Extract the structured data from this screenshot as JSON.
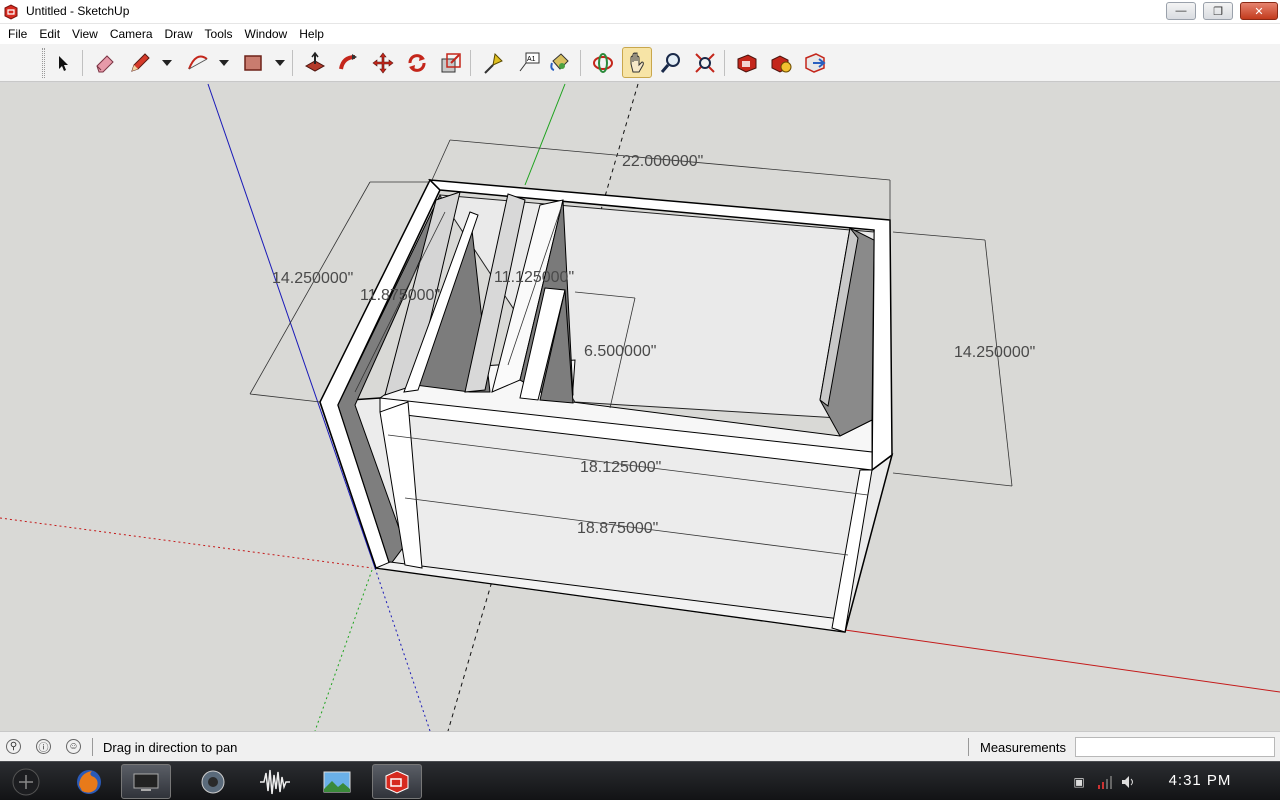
{
  "window": {
    "title": "Untitled - SketchUp",
    "minimize_label": "—",
    "restore_label": "❐",
    "close_label": "✕"
  },
  "menu": [
    "File",
    "Edit",
    "View",
    "Camera",
    "Draw",
    "Tools",
    "Window",
    "Help"
  ],
  "toolbar": {
    "tools": [
      {
        "name": "select-tool",
        "icon": "arrow-cursor-icon"
      },
      {
        "name": "eraser-tool",
        "icon": "eraser-icon"
      },
      {
        "name": "pencil-tool",
        "icon": "pencil-icon"
      },
      {
        "name": "arc-tool",
        "icon": "arc-icon"
      },
      {
        "name": "rectangle-tool",
        "icon": "rectangle-icon"
      },
      {
        "name": "push-pull-tool",
        "icon": "push-pull-icon"
      },
      {
        "name": "follow-me-tool",
        "icon": "follow-me-icon"
      },
      {
        "name": "move-tool",
        "icon": "move-icon"
      },
      {
        "name": "rotate-tool",
        "icon": "rotate-icon"
      },
      {
        "name": "scale-tool",
        "icon": "scale-icon"
      },
      {
        "name": "tape-measure-tool",
        "icon": "tape-measure-icon"
      },
      {
        "name": "text-tool",
        "icon": "text-label-icon"
      },
      {
        "name": "paint-bucket-tool",
        "icon": "paint-bucket-icon"
      },
      {
        "name": "orbit-tool",
        "icon": "orbit-icon"
      },
      {
        "name": "pan-tool",
        "icon": "hand-pan-icon",
        "active": true
      },
      {
        "name": "zoom-tool",
        "icon": "magnifier-icon"
      },
      {
        "name": "zoom-extents-tool",
        "icon": "zoom-extents-icon"
      },
      {
        "name": "warehouse-tool",
        "icon": "3d-warehouse-icon"
      },
      {
        "name": "components-tool",
        "icon": "components-icon"
      },
      {
        "name": "share-model-tool",
        "icon": "share-model-icon"
      }
    ],
    "text_tool_glyph": "A1"
  },
  "dimensions": {
    "top_width": "22.000000\"",
    "left_depth": "14.250000\"",
    "inner_depth": "11.875000\"",
    "port_depth": "11.125000\"",
    "port_width": "6.500000\"",
    "right_height": "14.250000\"",
    "inner_width": "18.125000\"",
    "front_width": "18.875000\""
  },
  "status": {
    "hint": "Drag in direction to pan",
    "measurements_label": "Measurements",
    "measurements_value": ""
  },
  "taskbar": {
    "apps": [
      "firefox-icon",
      "display-icon",
      "speaker-app-icon",
      "audio-wave-icon",
      "photo-viewer-icon",
      "sketchup-icon"
    ],
    "clock": "4:31 PM"
  },
  "colors": {
    "red_axis": "#c41a1a",
    "green_axis": "#1ea31e",
    "blue_axis": "#1a1ab8",
    "viewport_bg": "#d9d9d6",
    "active_tool": "#f7e4a6"
  }
}
